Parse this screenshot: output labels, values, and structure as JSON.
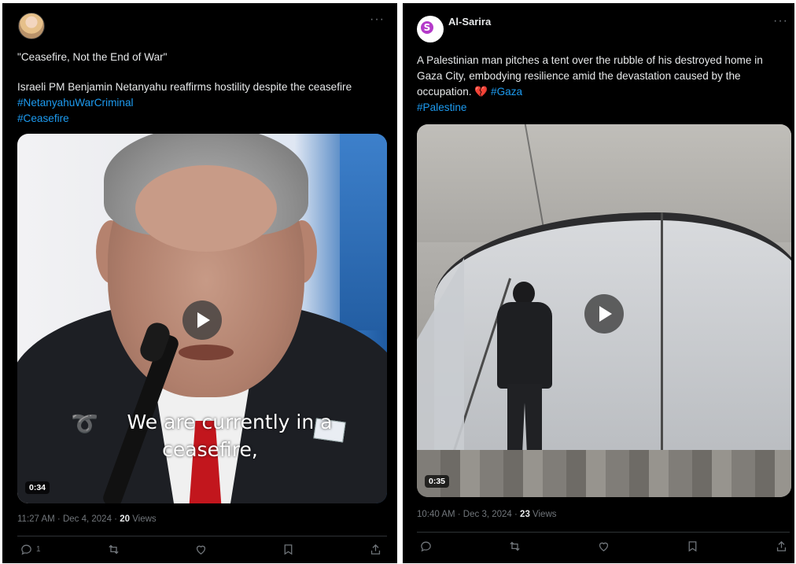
{
  "post1": {
    "author": "",
    "headline": "\"Ceasefire, Not the End of War\"",
    "body": "Israeli PM Benjamin Netanyahu reaffirms hostility despite the ceasefire",
    "hashtags": [
      "#NetanyahuWarCriminal",
      "#Ceasefire"
    ],
    "video": {
      "caption_line1": "We are currently in a",
      "caption_line2": "ceasefire,",
      "duration": "0:34"
    },
    "timestamp": "11:27 AM · Dec 4, 2024 · ",
    "views_count": "20",
    "views_label": " Views",
    "actions": {
      "reply_count": "1"
    }
  },
  "post2": {
    "author": "Al-Sarira",
    "avatar_text": "S",
    "body": "A Palestinian man pitches a tent over the rubble of his destroyed home in Gaza City, embodying resilience amid the devastation caused by the occupation.",
    "emoji": "💔",
    "hashtags": [
      "#Gaza",
      "#Palestine"
    ],
    "video": {
      "duration": "0:35"
    },
    "timestamp": "10:40 AM · Dec 3, 2024 · ",
    "views_count": "23",
    "views_label": " Views",
    "actions": {
      "reply_count": ""
    }
  },
  "colors": {
    "background": "#000000",
    "text": "#e7e9ea",
    "muted": "#71767b",
    "link": "#1d9bf0"
  }
}
